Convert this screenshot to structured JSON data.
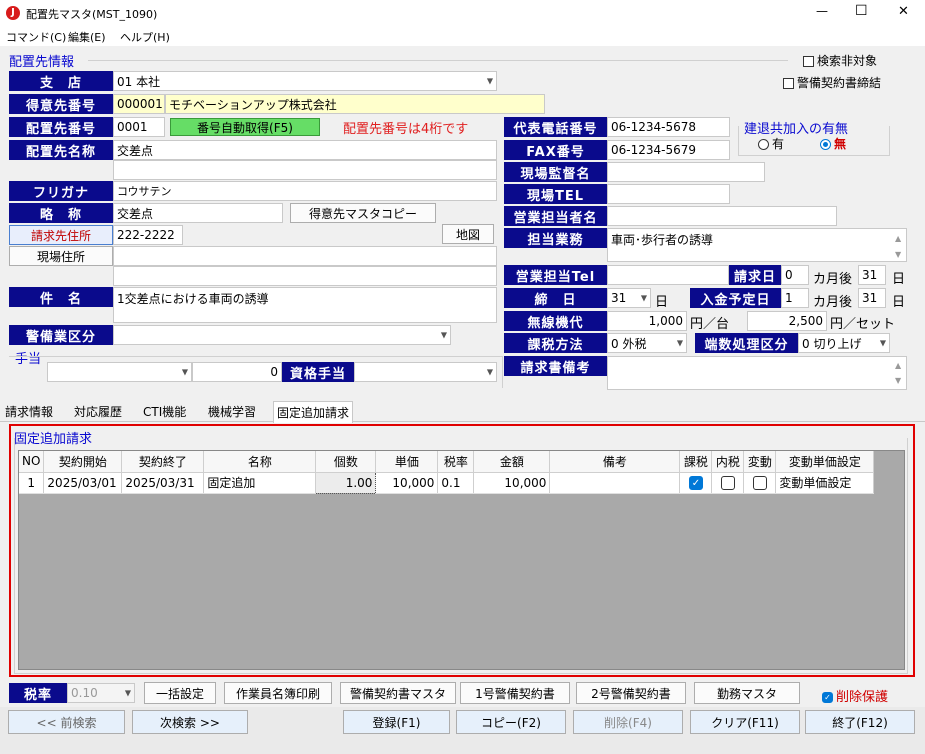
{
  "window": {
    "title": "配置先マスタ(MST_1090)",
    "min": "—",
    "max": "☐",
    "close": "✕"
  },
  "menu": [
    "コマンド(C)",
    "編集(E)",
    "ヘルプ(H)"
  ],
  "section_title": "配置先情報",
  "check_search_exclude": "検索非対象",
  "check_contract": "警備契約書締結",
  "branch": {
    "label": "支　店",
    "value": "01 本社"
  },
  "client": {
    "label": "得意先番号",
    "code": "000001",
    "name": "モチベーションアップ株式会社"
  },
  "site_no": {
    "label": "配置先番号",
    "value": "0001",
    "auto_btn": "番号自動取得(F5)",
    "warning": "配置先番号は4桁です"
  },
  "site_name": {
    "label": "配置先名称",
    "value": "交差点"
  },
  "furigana": {
    "label": "フリガナ",
    "value": "コウサテン"
  },
  "short_name": {
    "label": "略　称",
    "value": "交差点",
    "copy_btn": "得意先マスタコピー"
  },
  "billing_addr": {
    "label": "請求先住所",
    "value": "222-2222",
    "map_btn": "地図"
  },
  "site_addr": {
    "label": "現場住所"
  },
  "subject": {
    "label": "件　名",
    "value": "1交差点における車両の誘導"
  },
  "security_type": {
    "label": "警備業区分"
  },
  "allowance": {
    "title": "手当",
    "amount": "0",
    "qual_label": "資格手当"
  },
  "phone": {
    "label": "代表電話番号",
    "value": "06-1234-5678"
  },
  "fax": {
    "label": "FAX番号",
    "value": "06-1234-5679"
  },
  "kentai": {
    "title": "建退共加入の有無",
    "yes": "有",
    "no": "無"
  },
  "supervisor": {
    "label": "現場監督名"
  },
  "site_tel": {
    "label": "現場TEL"
  },
  "sales_person": {
    "label": "営業担当者名"
  },
  "duty": {
    "label": "担当業務",
    "value": "車両･歩行者の誘導"
  },
  "sales_tel": {
    "label": "営業担当Tel"
  },
  "bill_day": {
    "label": "請求日",
    "value": "0",
    "months_after": "カ月後",
    "day": "31",
    "day_unit": "日"
  },
  "close_day": {
    "label": "締　日",
    "value": "31",
    "unit": "日"
  },
  "pay_day": {
    "label": "入金予定日",
    "value": "1",
    "months_after": "カ月後",
    "day": "31",
    "day_unit": "日"
  },
  "radio_fee": {
    "label": "無線機代",
    "per_unit": "1,000",
    "per_unit_label": "円／台",
    "per_set": "2,500",
    "per_set_label": "円／セット"
  },
  "tax_method": {
    "label": "課税方法",
    "value": "0 外税"
  },
  "rounding": {
    "label": "端数処理区分",
    "value": "0 切り上げ"
  },
  "invoice_note": {
    "label": "請求書備考"
  },
  "tabs": [
    "請求情報",
    "対応履歴",
    "CTI機能",
    "機械学習",
    "固定追加請求"
  ],
  "fixed_title": "固定追加請求",
  "grid": {
    "headers": [
      "NO",
      "契約開始",
      "契約終了",
      "名称",
      "個数",
      "単価",
      "税率",
      "金額",
      "備考",
      "課税",
      "内税",
      "変動",
      "変動単価設定"
    ],
    "rows": [
      {
        "no": "1",
        "start": "2025/03/01",
        "end": "2025/03/31",
        "name": "固定追加",
        "qty": "1.00",
        "price": "10,000",
        "rate": "0.1",
        "amount": "10,000",
        "note": "",
        "taxable": true,
        "inclusive": false,
        "variable": false,
        "setting": "変動単価設定"
      }
    ]
  },
  "tax_rate": {
    "label": "税率",
    "value": "0.10"
  },
  "buttons_row1": [
    "一括設定",
    "作業員名簿印刷",
    "警備契約書マスタ",
    "1号警備契約書",
    "2号警備契約書",
    "勤務マスタ"
  ],
  "delete_protect": "削除保護",
  "buttons_row2": [
    "<< 前検索",
    "次検索 >>",
    "登録(F1)",
    "コピー(F2)",
    "削除(F4)",
    "クリア(F11)",
    "終了(F12)"
  ],
  "colors": {
    "label_bg": "#0a0a8c",
    "warning": "#e02020",
    "red_border": "#e00000",
    "auto_btn": "#66dd66",
    "section": "#0a0ad0"
  }
}
